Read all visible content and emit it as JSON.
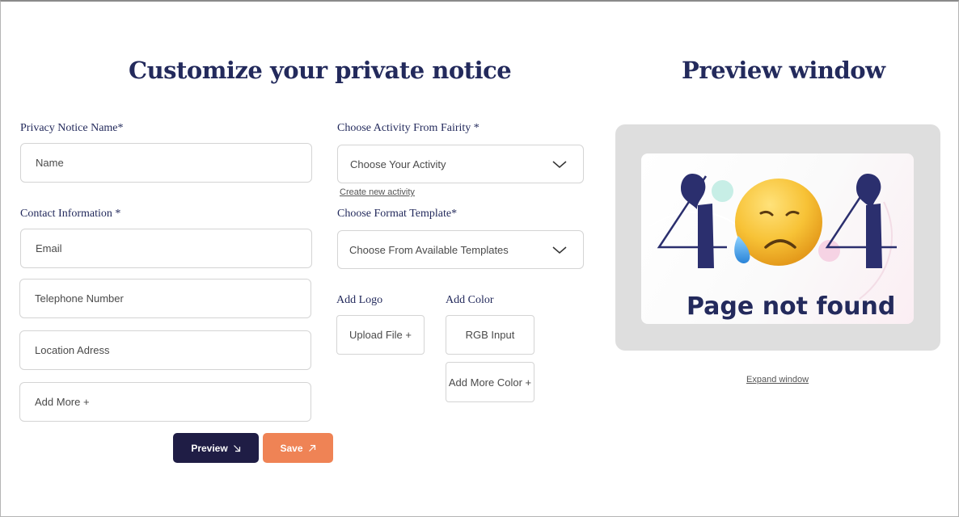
{
  "form": {
    "title": "Customize your private notice",
    "privacy_notice_name": {
      "label": "Privacy Notice Name*",
      "placeholder": "Name"
    },
    "contact": {
      "label": "Contact Information *",
      "fields": [
        "Email",
        "Telephone Number",
        "Location Adress",
        "Add More +"
      ]
    },
    "activity": {
      "label": "Choose Activity From Fairity *",
      "selected": "Choose Your Activity",
      "create_link": "Create new activity"
    },
    "template": {
      "label": "Choose Format Template*",
      "selected": "Choose From Available Templates"
    },
    "logo": {
      "label": "Add Logo",
      "button": "Upload File +"
    },
    "color": {
      "label": "Add Color",
      "rgb_input": "RGB Input",
      "add_more": "Add More Color +"
    },
    "actions": {
      "preview": "Preview",
      "save": "Save"
    }
  },
  "preview": {
    "title": "Preview window",
    "error_code_digits": [
      "4",
      "4"
    ],
    "error_message": "Page not found",
    "expand_link": "Expand window"
  },
  "colors": {
    "heading": "#232a5c",
    "preview_button": "#1f1d45",
    "save_button": "#ef8355",
    "frame": "#dedede"
  },
  "icons": {
    "chevron": "chevron-down-icon",
    "preview_arrow": "arrow-down-right-icon",
    "save_arrow": "arrow-up-right-icon",
    "emoji": "sad-sweat-face-emoji"
  }
}
